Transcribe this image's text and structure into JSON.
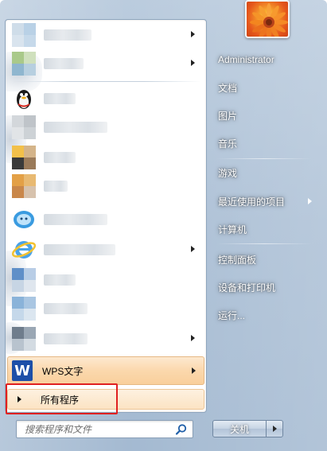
{
  "right_pane": {
    "username": "Administrator",
    "items": [
      {
        "label": "文档",
        "has_submenu": false
      },
      {
        "label": "图片",
        "has_submenu": false
      },
      {
        "label": "音乐",
        "has_submenu": false
      },
      {
        "label": "游戏",
        "has_submenu": false
      },
      {
        "label": "最近使用的项目",
        "has_submenu": true
      },
      {
        "label": "计算机",
        "has_submenu": false
      },
      {
        "label": "控制面板",
        "has_submenu": false
      },
      {
        "label": "设备和打印机",
        "has_submenu": false
      },
      {
        "label": "运行...",
        "has_submenu": false
      }
    ]
  },
  "left_pane": {
    "programs": [
      {
        "name": "",
        "blurred": true,
        "has_submenu": true,
        "icon": "blurred-app-icon"
      },
      {
        "name": "",
        "blurred": true,
        "has_submenu": true,
        "icon": "blurred-app-icon"
      },
      {
        "name": "",
        "blurred": true,
        "has_submenu": false,
        "icon": "qq-penguin-icon"
      },
      {
        "name": "",
        "blurred": true,
        "has_submenu": false,
        "icon": "blurred-app-icon"
      },
      {
        "name": "",
        "blurred": true,
        "has_submenu": false,
        "icon": "game-character-icon"
      },
      {
        "name": "",
        "blurred": true,
        "has_submenu": false,
        "icon": "blurred-app-icon"
      },
      {
        "name": "",
        "blurred": true,
        "has_submenu": false,
        "icon": "qq-chat-icon"
      },
      {
        "name": "",
        "blurred": true,
        "has_submenu": true,
        "icon": "internet-explorer-icon"
      },
      {
        "name": "",
        "blurred": true,
        "has_submenu": false,
        "icon": "blurred-app-icon"
      },
      {
        "name": "",
        "blurred": true,
        "has_submenu": false,
        "icon": "blurred-app-icon"
      },
      {
        "name": "",
        "blurred": true,
        "has_submenu": true,
        "icon": "blurred-app-icon"
      }
    ],
    "wps": {
      "label": "WPS文字",
      "logo_letter": "W",
      "icon": "wps-writer-icon"
    },
    "all_programs": {
      "label": "所有程序"
    }
  },
  "search": {
    "placeholder": "搜索程序和文件"
  },
  "shutdown": {
    "label": "关机"
  },
  "colors": {
    "highlight_orange": "#fbd8ad",
    "annotation_red": "#e02020",
    "wps_blue": "#1d4fa8",
    "glass_blue": "#a7bcd3"
  }
}
